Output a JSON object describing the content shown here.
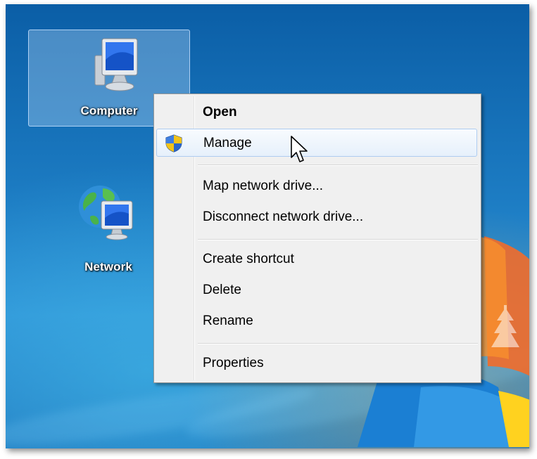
{
  "desktop": {
    "icons": [
      {
        "label": "Computer",
        "icon": "computer-icon",
        "selected": true
      },
      {
        "label": "Network",
        "icon": "network-icon",
        "selected": false
      }
    ]
  },
  "context_menu": {
    "items": [
      {
        "label": "Open",
        "bold": true
      },
      {
        "label": "Manage",
        "icon": "uac-shield-icon",
        "highlighted": true
      },
      {
        "label": "Map network drive..."
      },
      {
        "label": "Disconnect network drive..."
      },
      {
        "label": "Create shortcut"
      },
      {
        "label": "Delete"
      },
      {
        "label": "Rename"
      },
      {
        "label": "Properties"
      }
    ]
  },
  "colors": {
    "menu_bg": "#f0f0f0",
    "highlight_border": "#aeccf1",
    "desktop_blue": "#1d7dc4"
  }
}
